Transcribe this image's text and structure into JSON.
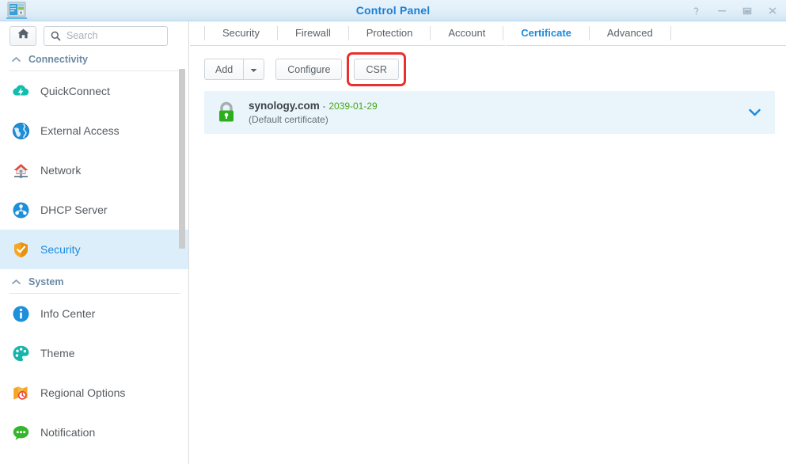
{
  "window": {
    "title": "Control Panel",
    "app_icon": "control-panel-icon",
    "controls": [
      {
        "name": "help-button",
        "glyph": "?"
      },
      {
        "name": "minimize-button",
        "glyph": "–"
      },
      {
        "name": "maximize-button",
        "glyph": "□"
      },
      {
        "name": "close-button",
        "glyph": "×"
      }
    ]
  },
  "sidebar": {
    "home_button": {
      "label": "",
      "icon": "home-icon"
    },
    "search": {
      "value": "",
      "placeholder": "Search",
      "icon": "search-icon"
    },
    "groups": [
      {
        "label": "Connectivity",
        "icon": "chevron-up-icon",
        "items": [
          {
            "label": "QuickConnect",
            "icon": "quickconnect-cloud-icon",
            "selected": false
          },
          {
            "label": "External Access",
            "icon": "globe-icon",
            "selected": false
          },
          {
            "label": "Network",
            "icon": "network-house-icon",
            "selected": false
          },
          {
            "label": "DHCP Server",
            "icon": "dhcp-server-icon",
            "selected": false
          },
          {
            "label": "Security",
            "icon": "shield-icon",
            "selected": true
          }
        ]
      },
      {
        "label": "System",
        "icon": "chevron-up-icon",
        "items": [
          {
            "label": "Info Center",
            "icon": "info-icon",
            "selected": false
          },
          {
            "label": "Theme",
            "icon": "palette-icon",
            "selected": false
          },
          {
            "label": "Regional Options",
            "icon": "regional-options-icon",
            "selected": false
          },
          {
            "label": "Notification",
            "icon": "notification-bubble-icon",
            "selected": false
          }
        ]
      }
    ]
  },
  "main": {
    "tabs": [
      {
        "label": "Security",
        "active": false
      },
      {
        "label": "Firewall",
        "active": false
      },
      {
        "label": "Protection",
        "active": false
      },
      {
        "label": "Account",
        "active": false
      },
      {
        "label": "Certificate",
        "active": true
      },
      {
        "label": "Advanced",
        "active": false
      }
    ],
    "toolbar": {
      "add_label": "Add",
      "add_dropdown_icon": "caret-down-icon",
      "configure_label": "Configure",
      "csr_label": "CSR",
      "csr_highlight_color": "#e8302d"
    },
    "certificates": [
      {
        "name": "synology.com",
        "separator": "-",
        "expiry": "2039-01-29",
        "subtitle": "(Default certificate)",
        "icon": "lock-icon",
        "expand_icon": "chevron-down-icon",
        "selected": true
      }
    ]
  },
  "colors": {
    "accent": "#1a8adf",
    "title": "#1a7fd4",
    "selected_row": "#e9f4fb",
    "selected_sidebar": "#ddeefb",
    "expiry_green": "#49a818",
    "highlight_red": "#e8302d"
  }
}
